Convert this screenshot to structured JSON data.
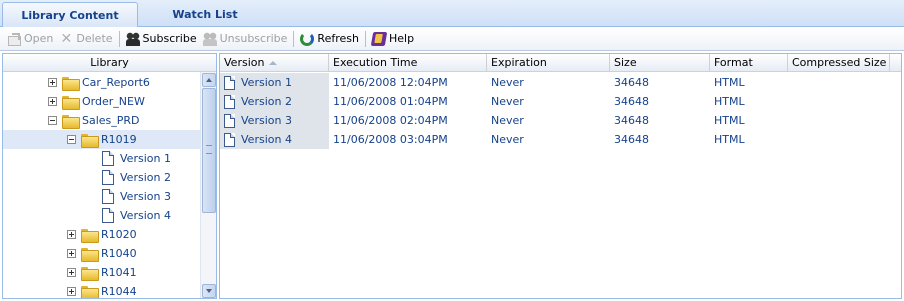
{
  "tabs": [
    {
      "label": "Library Content",
      "active": true
    },
    {
      "label": "Watch List",
      "active": false
    }
  ],
  "toolbar": {
    "open": "Open",
    "delete": "Delete",
    "subscribe": "Subscribe",
    "unsubscribe": "Unsubscribe",
    "refresh": "Refresh",
    "help": "Help"
  },
  "library": {
    "header": "Library",
    "nodes": [
      {
        "label": "Car_Report6",
        "kind": "folder",
        "toggle": "plus"
      },
      {
        "label": "Order_NEW",
        "kind": "folder",
        "toggle": "plus"
      },
      {
        "label": "Sales_PRD",
        "kind": "folder",
        "toggle": "minus"
      },
      {
        "label": "R1019",
        "kind": "folder",
        "toggle": "minus",
        "selected": true
      },
      {
        "label": "Version 1",
        "kind": "document"
      },
      {
        "label": "Version 2",
        "kind": "document"
      },
      {
        "label": "Version 3",
        "kind": "document"
      },
      {
        "label": "Version 4",
        "kind": "document"
      },
      {
        "label": "R1020",
        "kind": "folder",
        "toggle": "plus"
      },
      {
        "label": "R1040",
        "kind": "folder",
        "toggle": "plus"
      },
      {
        "label": "R1041",
        "kind": "folder",
        "toggle": "plus"
      },
      {
        "label": "R1044",
        "kind": "folder",
        "toggle": "plus"
      }
    ]
  },
  "grid": {
    "columns": [
      "Version",
      "Execution Time",
      "Expiration",
      "Size",
      "Format",
      "Compressed Size"
    ],
    "sorted_column": "Version",
    "rows": [
      {
        "version": "Version 1",
        "execution_time": "11/06/2008 12:04PM",
        "expiration": "Never",
        "size": "34648",
        "format": "HTML",
        "compressed_size": ""
      },
      {
        "version": "Version 2",
        "execution_time": "11/06/2008 01:04PM",
        "expiration": "Never",
        "size": "34648",
        "format": "HTML",
        "compressed_size": ""
      },
      {
        "version": "Version 3",
        "execution_time": "11/06/2008 02:04PM",
        "expiration": "Never",
        "size": "34648",
        "format": "HTML",
        "compressed_size": ""
      },
      {
        "version": "Version 4",
        "execution_time": "11/06/2008 03:04PM",
        "expiration": "Never",
        "size": "34648",
        "format": "HTML",
        "compressed_size": ""
      }
    ]
  },
  "icons": {
    "open": "open-icon",
    "delete": "delete-icon",
    "subscribe": "subscribe-icon",
    "unsubscribe": "unsubscribe-icon",
    "refresh": "refresh-icon",
    "help": "help-icon",
    "folder": "folder-icon",
    "document": "document-icon"
  },
  "colors": {
    "accent_text": "#15428b",
    "border": "#99bbe8",
    "tab_bar": "#cfe0f6",
    "selected_row": "#dfe8f6",
    "folder": "#e7b92b"
  }
}
